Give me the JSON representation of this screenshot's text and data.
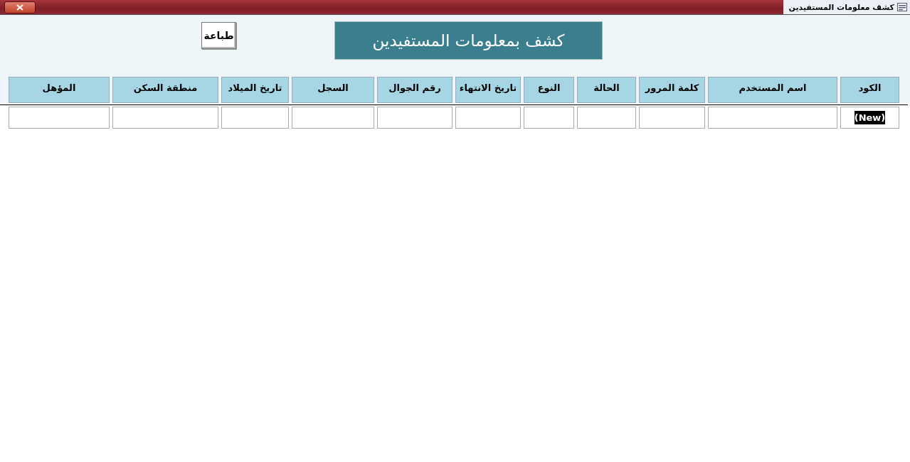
{
  "window": {
    "title": "كشف معلومات المستفيدين"
  },
  "print_button": {
    "label": "طباعة"
  },
  "heading": "كشف بمعلومات المستفيدين",
  "table": {
    "columns": [
      "الكود",
      "اسم المستخدم",
      "كلمة المرور",
      "الحالة",
      "النوع",
      "تاريخ الانتهاء",
      "رقم الجوال",
      "السجل",
      "تاريخ الميلاد",
      "منطقة السكن",
      "المؤهل"
    ],
    "rows": [
      {
        "code": "(New)"
      }
    ]
  }
}
